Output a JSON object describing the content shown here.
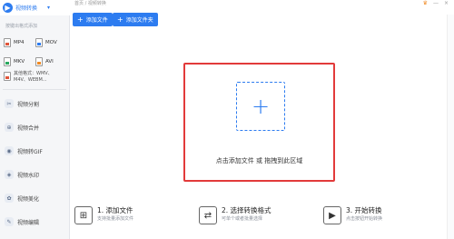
{
  "sidebar": {
    "title": "视频转换",
    "hint": "按键出格式添加",
    "formats": [
      {
        "label": "MP4",
        "color": "#e0553a"
      },
      {
        "label": "MOV",
        "color": "#2d7cf0"
      },
      {
        "label": "MKV",
        "color": "#2aa860"
      },
      {
        "label": "AVI",
        "color": "#f08a24"
      }
    ],
    "other_formats": "其他格式：WMV、M4V、WEBM...",
    "nav": [
      {
        "label": "视频分割",
        "icon": "scissors-icon"
      },
      {
        "label": "视频合并",
        "icon": "merge-icon"
      },
      {
        "label": "视频转GIF",
        "icon": "gif-icon"
      },
      {
        "label": "视频水印",
        "icon": "watermark-icon"
      },
      {
        "label": "视频美化",
        "icon": "beautify-icon"
      },
      {
        "label": "视频编辑",
        "icon": "edit-icon"
      }
    ]
  },
  "breadcrumb": "首页 / 视频转换",
  "toolbar": {
    "add_file": "添加文件",
    "add_folder": "添加文件夹"
  },
  "dropzone": {
    "text": "点击添加文件 或 拖拽到此区域"
  },
  "steps": [
    {
      "title": "1. 添加文件",
      "desc": "支持批量添加文件",
      "icon": "add-file-icon"
    },
    {
      "title": "2. 选择转换格式",
      "desc": "可单个或者批量选择",
      "icon": "convert-format-icon"
    },
    {
      "title": "3. 开始转换",
      "desc": "点击按钮开始转换",
      "icon": "play-video-icon"
    }
  ],
  "colors": {
    "accent": "#2d7cf0",
    "highlight_border": "#e23a3a"
  }
}
